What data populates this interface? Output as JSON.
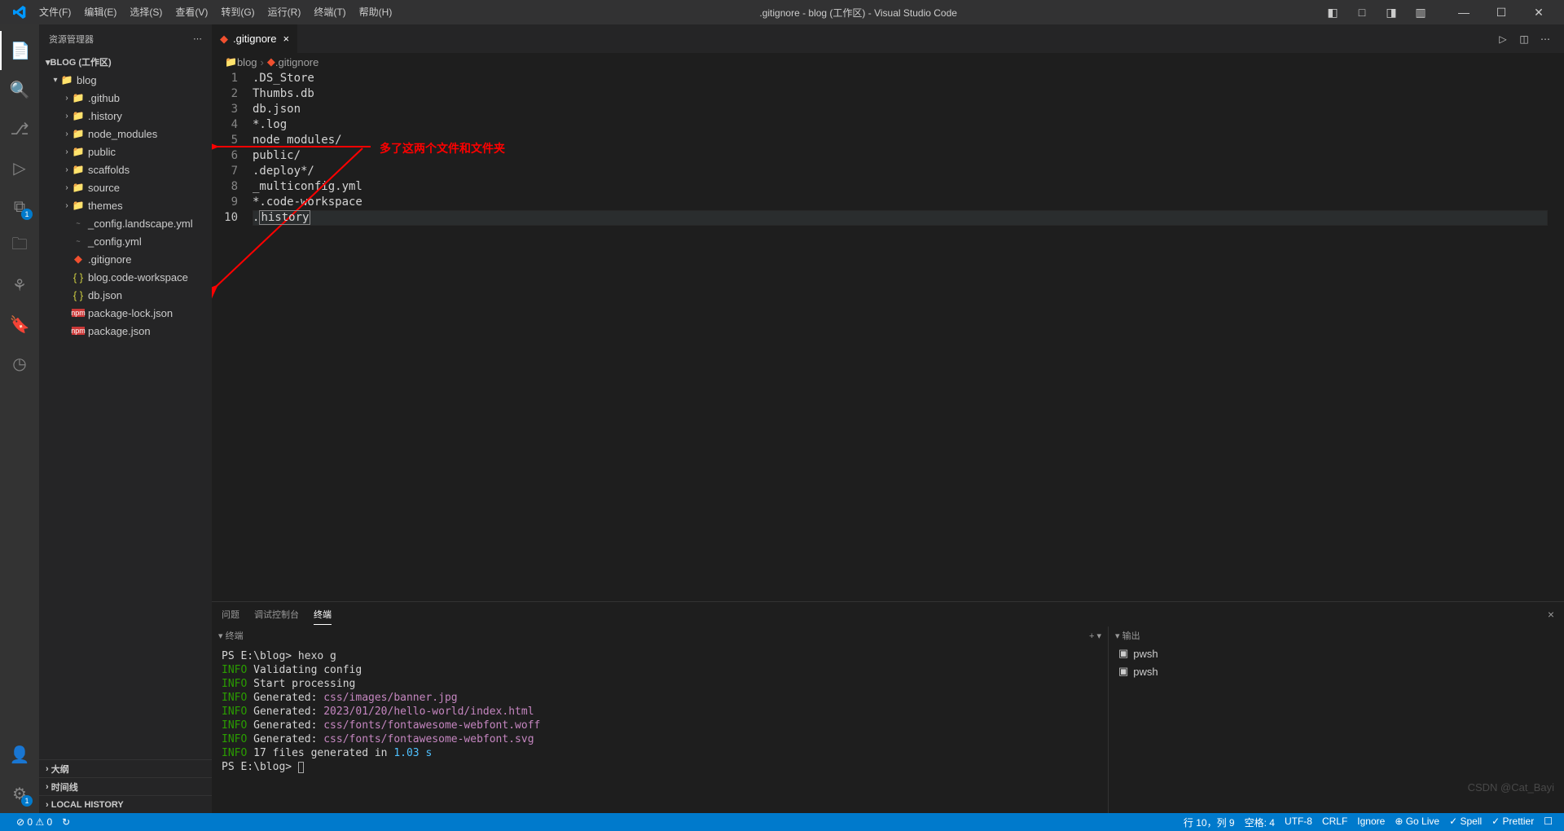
{
  "titlebar": {
    "menus": [
      "文件(F)",
      "编辑(E)",
      "选择(S)",
      "查看(V)",
      "转到(G)",
      "运行(R)",
      "终端(T)",
      "帮助(H)"
    ],
    "title": ".gitignore - blog (工作区) - Visual Studio Code"
  },
  "sidebar": {
    "title": "资源管理器",
    "workspace": "BLOG (工作区)",
    "root": "blog",
    "tree": [
      {
        "indent": 1,
        "arrow": "▾",
        "icon": "folder",
        "label": "blog"
      },
      {
        "indent": 2,
        "arrow": "›",
        "icon": "folder-gh",
        "label": ".github"
      },
      {
        "indent": 2,
        "arrow": "›",
        "icon": "folder",
        "label": ".history"
      },
      {
        "indent": 2,
        "arrow": "›",
        "icon": "folder-nm",
        "label": "node_modules"
      },
      {
        "indent": 2,
        "arrow": "›",
        "icon": "folder-pub",
        "label": "public"
      },
      {
        "indent": 2,
        "arrow": "›",
        "icon": "folder",
        "label": "scaffolds"
      },
      {
        "indent": 2,
        "arrow": "›",
        "icon": "folder-src",
        "label": "source"
      },
      {
        "indent": 2,
        "arrow": "›",
        "icon": "folder",
        "label": "themes"
      },
      {
        "indent": 2,
        "arrow": "",
        "icon": "yml",
        "label": "_config.landscape.yml"
      },
      {
        "indent": 2,
        "arrow": "",
        "icon": "yml",
        "label": "_config.yml"
      },
      {
        "indent": 2,
        "arrow": "",
        "icon": "git",
        "label": ".gitignore"
      },
      {
        "indent": 2,
        "arrow": "",
        "icon": "json",
        "label": "blog.code-workspace"
      },
      {
        "indent": 2,
        "arrow": "",
        "icon": "json",
        "label": "db.json"
      },
      {
        "indent": 2,
        "arrow": "",
        "icon": "npm",
        "label": "package-lock.json"
      },
      {
        "indent": 2,
        "arrow": "",
        "icon": "npm",
        "label": "package.json"
      }
    ],
    "sections": [
      "大纲",
      "时间线",
      "LOCAL HISTORY"
    ]
  },
  "tabs": {
    "active": ".gitignore"
  },
  "breadcrumb": [
    "blog",
    ".gitignore"
  ],
  "editor": {
    "lines": [
      ".DS_Store",
      "Thumbs.db",
      "db.json",
      "*.log",
      "node_modules/",
      "public/",
      ".deploy*/",
      "_multiconfig.yml",
      "*.code-workspace",
      ".history"
    ],
    "currentLine": 10,
    "selectionText": "history"
  },
  "annotation": {
    "text": "多了这两个文件和文件夹"
  },
  "panel": {
    "tabs": [
      "问题",
      "调试控制台",
      "终端"
    ],
    "active": "终端",
    "termHeader": "终端",
    "outputHeader": "输出",
    "terminal_lines": [
      {
        "pre": "PS E:\\blog> ",
        "cmd": "hexo g"
      },
      {
        "info": "INFO",
        "text": "  Validating config"
      },
      {
        "info": "INFO",
        "text": "  Start processing"
      },
      {
        "info": "INFO",
        "text": "  Generated: ",
        "gen": "css/images/banner.jpg"
      },
      {
        "info": "INFO",
        "text": "  Generated: ",
        "gen": "2023/01/20/hello-world/index.html"
      },
      {
        "info": "INFO",
        "text": "  Generated: ",
        "gen": "css/fonts/fontawesome-webfont.woff"
      },
      {
        "info": "INFO",
        "text": "  Generated: ",
        "gen": "css/fonts/fontawesome-webfont.svg"
      },
      {
        "info": "INFO",
        "text": "  17 files generated in ",
        "time": "1.03 s"
      },
      {
        "pre": "PS E:\\blog> ",
        "cursor": true
      }
    ],
    "term_list": [
      "pwsh",
      "pwsh"
    ]
  },
  "statusbar": {
    "left": [
      "⊘ 0 ⚠ 0",
      "↻"
    ],
    "right": [
      "行 10，列 9",
      "空格: 4",
      "UTF-8",
      "CRLF",
      "Ignore",
      "⊕ Go Live",
      "✓ Spell",
      "✓ Prettier",
      "☐"
    ],
    "remote": "⚙"
  },
  "watermark": "CSDN @Cat_Bayi"
}
